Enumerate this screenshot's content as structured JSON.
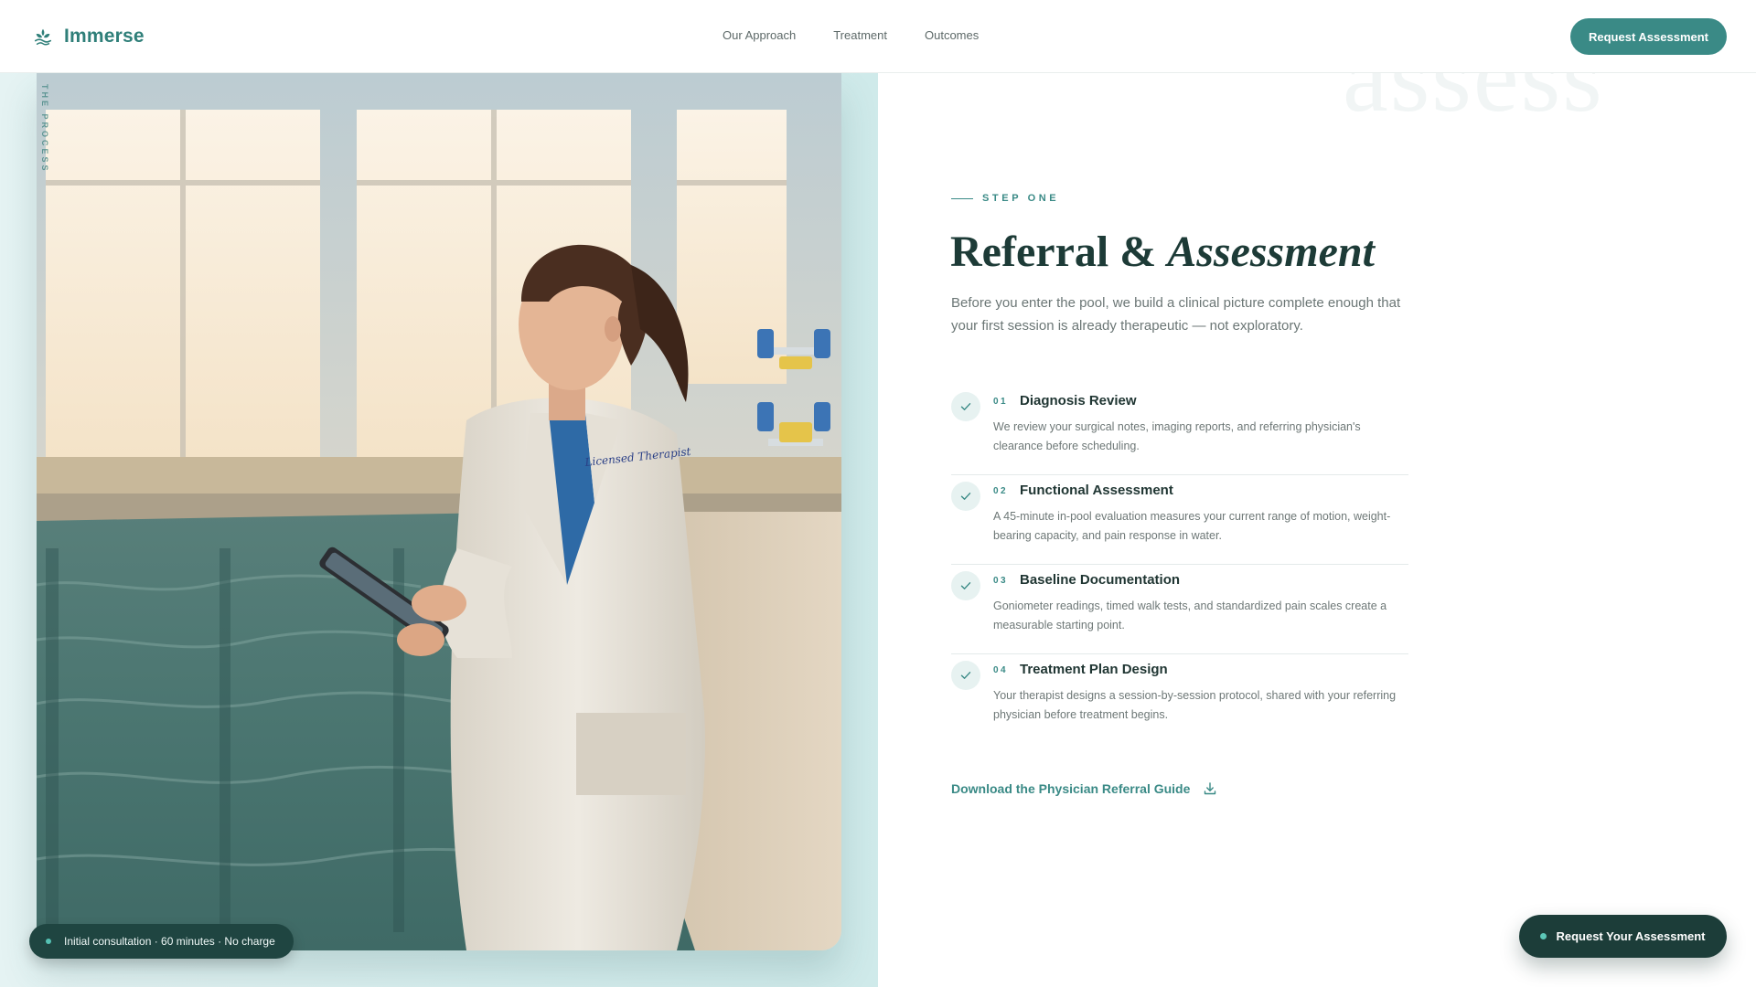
{
  "brand": {
    "name": "Immerse",
    "icon": "lotus-wave-icon"
  },
  "nav": {
    "items": [
      "Our Approach",
      "Treatment",
      "Outcomes"
    ]
  },
  "header": {
    "cta_label": "Request Assessment"
  },
  "hero_image": {
    "vertical_label": "The Process",
    "badge_text": "Initial consultation · 60 minutes · No charge",
    "coat_embroidery": "Licensed Therapist"
  },
  "section": {
    "ghost_word": "assess",
    "eyebrow": "STEP ONE",
    "title_plain": "Referral & ",
    "title_italic": "Assessment",
    "intro": "Before you enter the pool, we build a clinical picture complete enough that your first session is already therapeutic — not exploratory."
  },
  "steps": [
    {
      "number": "01",
      "title": "Diagnosis Review",
      "description": "We review your surgical notes, imaging reports, and referring physician's clearance before scheduling.",
      "icon": "check-icon"
    },
    {
      "number": "02",
      "title": "Functional Assessment",
      "description": "A 45-minute in-pool evaluation measures your current range of motion, weight-bearing capacity, and pain response in water.",
      "icon": "check-icon"
    },
    {
      "number": "03",
      "title": "Baseline Documentation",
      "description": "Goniometer readings, timed walk tests, and standardized pain scales create a measurable starting point.",
      "icon": "check-icon"
    },
    {
      "number": "04",
      "title": "Treatment Plan Design",
      "description": "Your therapist designs a session-by-session protocol, shared with your referring physician before treatment begins.",
      "icon": "check-icon"
    }
  ],
  "download": {
    "label": "Download the Physician Referral Guide",
    "icon": "download-icon"
  },
  "floating_cta": {
    "label": "Request Your Assessment"
  },
  "colors": {
    "accent": "#3a8a86",
    "dark": "#1c3d39",
    "title": "#1d3b37",
    "panel": "#d8efef"
  }
}
